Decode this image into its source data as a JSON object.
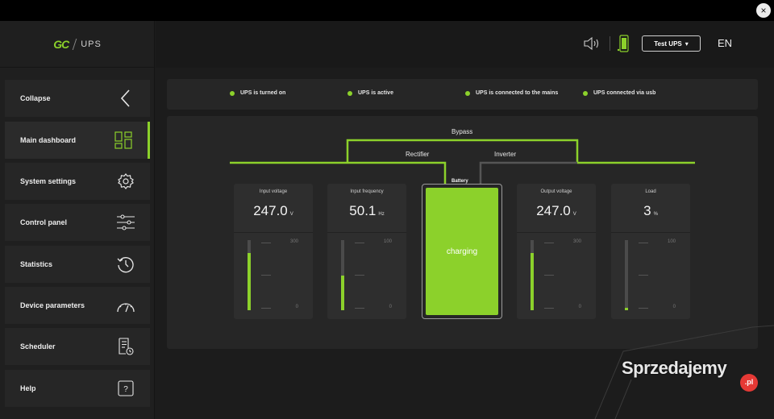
{
  "window": {
    "close_glyph": "×"
  },
  "brand": {
    "mark": "GC",
    "name": "UPS"
  },
  "sidebar": {
    "items": [
      {
        "label": "Collapse",
        "icon": "chevron-left-icon"
      },
      {
        "label": "Main dashboard",
        "icon": "dashboard-grid-icon",
        "active": true
      },
      {
        "label": "System settings",
        "icon": "gear-icon"
      },
      {
        "label": "Control panel",
        "icon": "sliders-icon"
      },
      {
        "label": "Statistics",
        "icon": "history-clock-icon"
      },
      {
        "label": "Device parameters",
        "icon": "gauge-icon"
      },
      {
        "label": "Scheduler",
        "icon": "schedule-document-icon"
      },
      {
        "label": "Help",
        "icon": "help-question-icon"
      }
    ]
  },
  "header": {
    "ups_select": {
      "value": "Test UPS",
      "caret": "▾"
    },
    "language": "EN"
  },
  "status": [
    {
      "text": "UPS is turned on"
    },
    {
      "text": "UPS is active"
    },
    {
      "text": "UPS is connected to the mains"
    },
    {
      "text": "UPS connected via usb"
    }
  ],
  "flow": {
    "bypass": "Bypass",
    "rectifier": "Rectifier",
    "inverter": "Inverter"
  },
  "battery": {
    "label": "Battery",
    "status": "charging"
  },
  "cards": {
    "input_voltage": {
      "title": "Input voltage",
      "value": "247.0",
      "unit": "V",
      "max": "300",
      "min": "0",
      "level": 0.82
    },
    "input_frequency": {
      "title": "Input frequency",
      "value": "50.1",
      "unit": "Hz",
      "max": "100",
      "min": "0",
      "level": 0.5
    },
    "output_voltage": {
      "title": "Output voltage",
      "value": "247.0",
      "unit": "V",
      "max": "300",
      "min": "0",
      "level": 0.82
    },
    "load": {
      "title": "Load",
      "value": "3",
      "unit": "%",
      "max": "100",
      "min": "0",
      "level": 0.03
    }
  },
  "colors": {
    "accent": "#8cd12b",
    "panel": "#262626",
    "background": "#1c1c1c"
  },
  "watermark": {
    "text": "Sprzedajemy",
    "tld": ".pl"
  }
}
